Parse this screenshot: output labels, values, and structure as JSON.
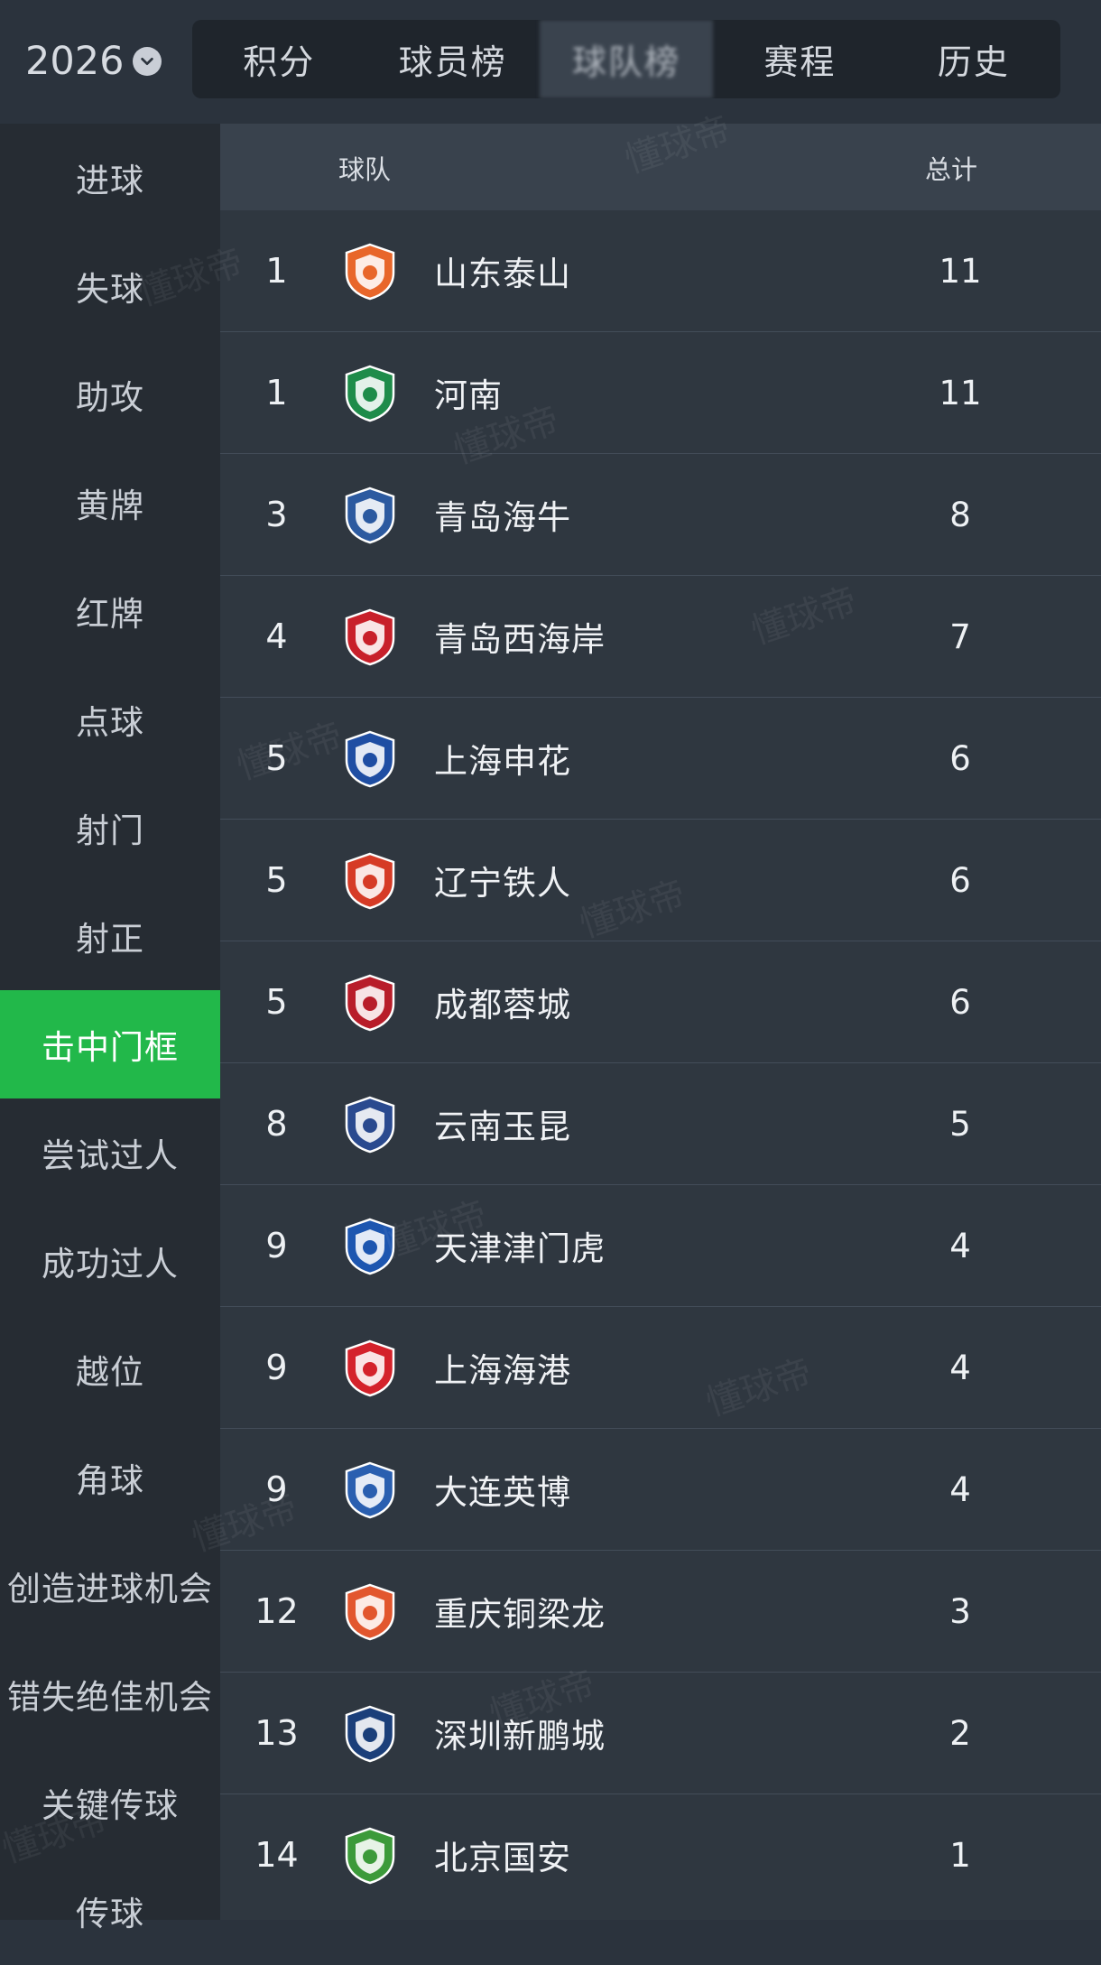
{
  "header": {
    "season": "2026",
    "tabs": [
      {
        "label": "积分"
      },
      {
        "label": "球员榜"
      },
      {
        "label": "球队榜"
      },
      {
        "label": "赛程"
      },
      {
        "label": "历史"
      }
    ],
    "active_tab_index": 2
  },
  "sidebar": {
    "items": [
      {
        "label": "进球"
      },
      {
        "label": "失球"
      },
      {
        "label": "助攻"
      },
      {
        "label": "黄牌"
      },
      {
        "label": "红牌"
      },
      {
        "label": "点球"
      },
      {
        "label": "射门"
      },
      {
        "label": "射正"
      },
      {
        "label": "击中门框"
      },
      {
        "label": "尝试过人"
      },
      {
        "label": "成功过人"
      },
      {
        "label": "越位"
      },
      {
        "label": "角球"
      },
      {
        "label": "创造进球机会"
      },
      {
        "label": "错失绝佳机会"
      },
      {
        "label": "关键传球"
      },
      {
        "label": "传球"
      }
    ],
    "active_index": 8
  },
  "table": {
    "columns": {
      "team": "球队",
      "total": "总计"
    },
    "rows": [
      {
        "rank": "1",
        "team": "山东泰山",
        "total": "11",
        "logo": "shandong-taishan-logo",
        "color": "#e8662a"
      },
      {
        "rank": "1",
        "team": "河南",
        "total": "11",
        "logo": "henan-logo",
        "color": "#1e8c4a"
      },
      {
        "rank": "3",
        "team": "青岛海牛",
        "total": "8",
        "logo": "qingdao-hainiu-logo",
        "color": "#2c5aa0"
      },
      {
        "rank": "4",
        "team": "青岛西海岸",
        "total": "7",
        "logo": "qingdao-west-coast-logo",
        "color": "#c8202a"
      },
      {
        "rank": "5",
        "team": "上海申花",
        "total": "6",
        "logo": "shanghai-shenhua-logo",
        "color": "#1f4ea3"
      },
      {
        "rank": "5",
        "team": "辽宁铁人",
        "total": "6",
        "logo": "liaoning-tieren-logo",
        "color": "#d63b26"
      },
      {
        "rank": "5",
        "team": "成都蓉城",
        "total": "6",
        "logo": "chengdu-rongcheng-logo",
        "color": "#b81d2a"
      },
      {
        "rank": "8",
        "team": "云南玉昆",
        "total": "5",
        "logo": "yunnan-yukun-logo",
        "color": "#2a4a8f"
      },
      {
        "rank": "9",
        "team": "天津津门虎",
        "total": "4",
        "logo": "tianjin-jinmen-tiger-logo",
        "color": "#1d56b0"
      },
      {
        "rank": "9",
        "team": "上海海港",
        "total": "4",
        "logo": "shanghai-port-logo",
        "color": "#d4222b"
      },
      {
        "rank": "9",
        "team": "大连英博",
        "total": "4",
        "logo": "dalian-yingbo-logo",
        "color": "#2a5fb0"
      },
      {
        "rank": "12",
        "team": "重庆铜梁龙",
        "total": "3",
        "logo": "chongqing-tongliang-long-logo",
        "color": "#e2562e"
      },
      {
        "rank": "13",
        "team": "深圳新鹏城",
        "total": "2",
        "logo": "shenzhen-xinpengcheng-logo",
        "color": "#1b3f7a"
      },
      {
        "rank": "14",
        "team": "北京国安",
        "total": "1",
        "logo": "beijing-guoan-logo",
        "color": "#3c9a3a"
      }
    ]
  },
  "watermark": {
    "text": "懂球帝"
  }
}
